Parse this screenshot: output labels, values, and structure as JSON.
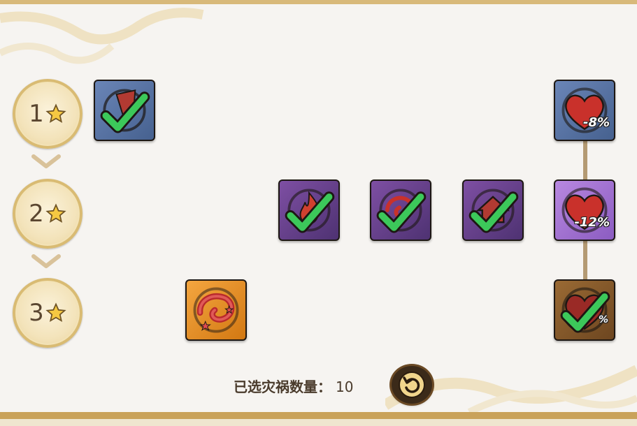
{
  "tiers": [
    {
      "label": "1"
    },
    {
      "label": "2"
    },
    {
      "label": "3"
    }
  ],
  "slots": {
    "row1_left": {
      "icon": "banner-icon",
      "selected": true
    },
    "row1_right": {
      "icon": "heart-icon",
      "value": "-8%"
    },
    "row2_a": {
      "icon": "flame-icon",
      "selected": true
    },
    "row2_b": {
      "icon": "vortex-icon",
      "selected": true
    },
    "row2_c": {
      "icon": "house-icon",
      "selected": true
    },
    "row2_right": {
      "icon": "heart-icon",
      "value": "-12%"
    },
    "row3_left": {
      "icon": "swirl-icon",
      "selected": false
    },
    "row3_right": {
      "icon": "heart-icon",
      "value": "%",
      "selected": true
    }
  },
  "footer": {
    "count_label": "已选灾祸数量：",
    "count_value": "10"
  },
  "colors": {
    "check_green": "#3cc85a",
    "heart_red": "#c9312b",
    "gold": "#d9bb73"
  }
}
